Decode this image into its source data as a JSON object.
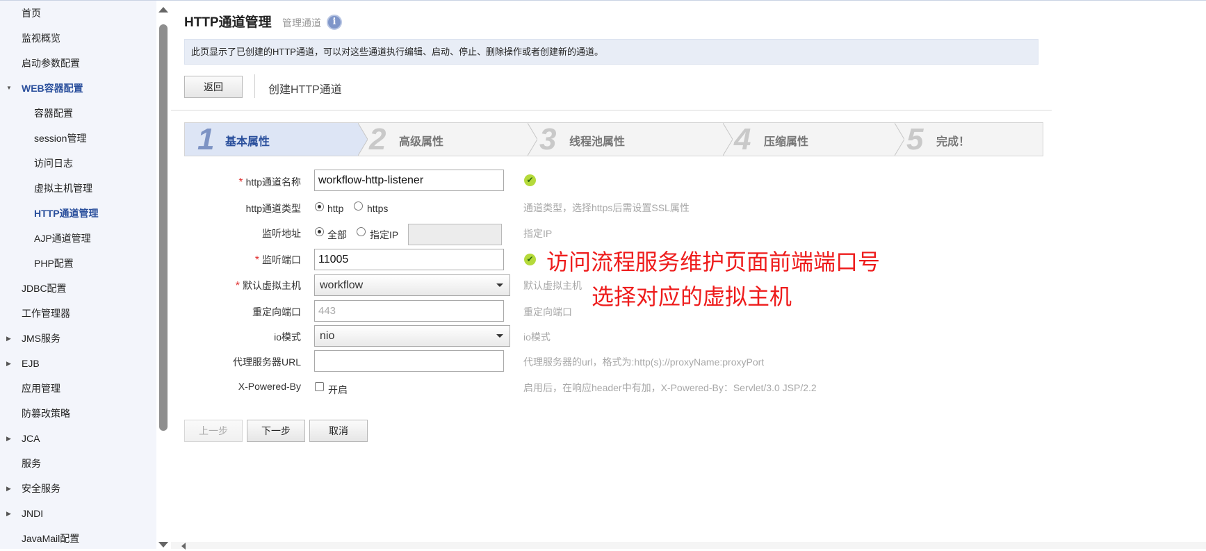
{
  "sidebar": {
    "items": [
      {
        "label": "首页"
      },
      {
        "label": "监视概览"
      },
      {
        "label": "启动参数配置"
      },
      {
        "label": "WEB容器配置"
      },
      {
        "label": "容器配置"
      },
      {
        "label": "session管理"
      },
      {
        "label": "访问日志"
      },
      {
        "label": "虚拟主机管理"
      },
      {
        "label": "HTTP通道管理"
      },
      {
        "label": "AJP通道管理"
      },
      {
        "label": "PHP配置"
      },
      {
        "label": "JDBC配置"
      },
      {
        "label": "工作管理器"
      },
      {
        "label": "JMS服务"
      },
      {
        "label": "EJB"
      },
      {
        "label": "应用管理"
      },
      {
        "label": "防篡改策略"
      },
      {
        "label": "JCA"
      },
      {
        "label": "服务"
      },
      {
        "label": "安全服务"
      },
      {
        "label": "JNDI"
      },
      {
        "label": "JavaMail配置"
      }
    ]
  },
  "header": {
    "title": "HTTP通道管理",
    "subtitle": "管理通道",
    "info_glyph": "i",
    "description": "此页显示了已创建的HTTP通道，可以对这些通道执行编辑、启动、停止、删除操作或者创建新的通道。"
  },
  "toolbar": {
    "back_label": "返回",
    "crumb": "创建HTTP通道"
  },
  "steps": [
    {
      "num": "1",
      "label": "基本属性"
    },
    {
      "num": "2",
      "label": "高级属性"
    },
    {
      "num": "3",
      "label": "线程池属性"
    },
    {
      "num": "4",
      "label": "压缩属性"
    },
    {
      "num": "5",
      "label": "完成！"
    }
  ],
  "form": {
    "name": {
      "label": "http通道名称",
      "value": "workflow-http-listener"
    },
    "type": {
      "label": "http通道类型",
      "opt1": "http",
      "opt2": "https",
      "hint": "通道类型，选择https后需设置SSL属性"
    },
    "addr": {
      "label": "监听地址",
      "opt1": "全部",
      "opt2": "指定IP",
      "hint": "指定IP"
    },
    "port": {
      "label": "监听端口",
      "value": "11005"
    },
    "vhost": {
      "label": "默认虚拟主机",
      "value": "workflow",
      "hint": "默认虚拟主机"
    },
    "redirect": {
      "label": "重定向端口",
      "placeholder": "443",
      "hint": "重定向端口"
    },
    "io": {
      "label": "io模式",
      "value": "nio",
      "hint": "io模式"
    },
    "proxy": {
      "label": "代理服务器URL",
      "value": "",
      "hint": "代理服务器的url，格式为:http(s)://proxyName:proxyPort"
    },
    "powered": {
      "label": "X-Powered-By",
      "opt": "开启",
      "hint": "启用后，在响应header中有加，X-Powered-By：Servlet/3.0 JSP/2.2"
    },
    "required_mark": "*",
    "ok_glyph": "✔"
  },
  "buttons": {
    "prev": "上一步",
    "next": "下一步",
    "cancel": "取消"
  },
  "annotations": {
    "port_note": "访问流程服务维护页面前端端口号",
    "vhost_note": "选择对应的虚拟主机"
  },
  "colors": {
    "accent": "#2a4f9c",
    "annotation": "#ee1c1c",
    "sidebar_bg": "#f3f5fb",
    "ok_green": "#b5da3b"
  }
}
